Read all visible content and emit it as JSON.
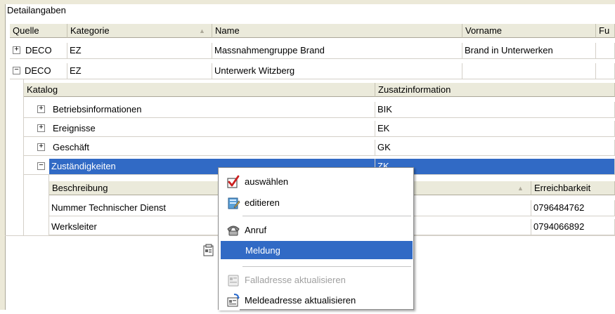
{
  "panel_title": "Detailangaben",
  "main_headers": {
    "quelle": "Quelle",
    "kategorie": "Kategorie",
    "name": "Name",
    "vorname": "Vorname",
    "fu": "Fu"
  },
  "main_rows": [
    {
      "expander": "+",
      "quelle": "DECO",
      "kategorie": "EZ",
      "name": "Massnahmengruppe Brand",
      "vorname": "Brand in Unterwerken"
    },
    {
      "expander": "−",
      "quelle": "DECO",
      "kategorie": "EZ",
      "name": "Unterwerk Witzberg",
      "vorname": ""
    }
  ],
  "sub_headers": {
    "katalog": "Katalog",
    "zusatz": "Zusatzinformation"
  },
  "sub_rows": [
    {
      "expander": "+",
      "katalog": "Betriebsinformationen",
      "zusatz": "BIK"
    },
    {
      "expander": "+",
      "katalog": "Ereignisse",
      "zusatz": "EK"
    },
    {
      "expander": "+",
      "katalog": "Geschäft",
      "zusatz": "GK"
    },
    {
      "expander": "−",
      "katalog": "Zuständigkeiten",
      "zusatz": "ZK"
    }
  ],
  "subsub_headers": {
    "beschreibung": "Beschreibung",
    "erreichbarkeit": "Erreichbarkeit"
  },
  "subsub_rows": [
    {
      "beschreibung": "Nummer Technischer Dienst",
      "erreichbarkeit": "0796484762"
    },
    {
      "beschreibung": "Werksleiter",
      "erreichbarkeit": "0794066892"
    }
  ],
  "context_menu": {
    "items": [
      {
        "label": "auswählen",
        "icon": "checkbox-check-icon"
      },
      {
        "label": "editieren",
        "icon": "edit-notebook-icon"
      },
      {
        "label": "Anruf",
        "icon": "telephone-icon"
      },
      {
        "label": "Meldung",
        "icon": "message-document-icon"
      },
      {
        "label": "Falladresse aktualisieren",
        "icon": "address-card-icon"
      },
      {
        "label": "Meldeadresse aktualisieren",
        "icon": "address-refresh-icon"
      }
    ]
  },
  "colors": {
    "selection": "#316ac5",
    "header_bg": "#ebeadb",
    "check_red": "#cc2020"
  }
}
